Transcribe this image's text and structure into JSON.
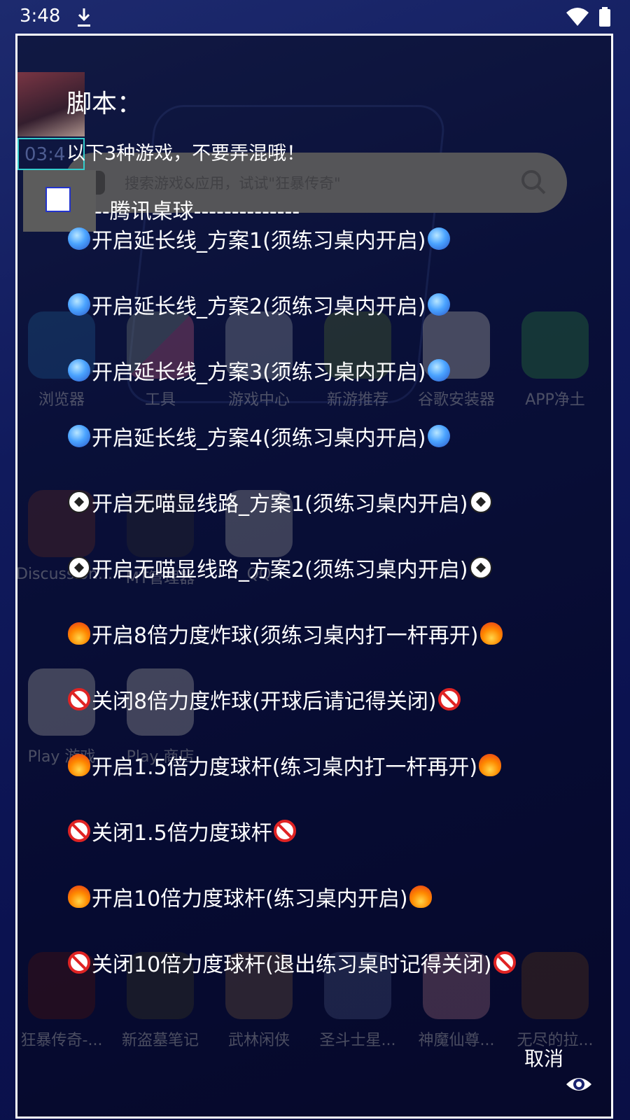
{
  "status_bar": {
    "time": "3:48"
  },
  "launcher": {
    "search_placeholder": "搜索游戏&应用，试试\"狂暴传奇\"",
    "row1": [
      "浏览器",
      "工具",
      "游戏中心",
      "新游推荐",
      "谷歌安装器",
      "APP净土"
    ],
    "row2": [
      "Discussion...",
      "MT管理器",
      "QQ"
    ],
    "row3": [
      "Play 游戏",
      "Play 商店"
    ],
    "dock": [
      "狂暴传奇-...",
      "新盗墓笔记",
      "武林闲侠",
      "圣斗士星...",
      "神魔仙尊...",
      "无尽的拉..."
    ]
  },
  "dialog": {
    "title": "脚本：",
    "subtitle": "以下3种游戏，不要弄混哦！",
    "overlay_time": "03:4",
    "section_label": "--腾讯桌球--------------",
    "options": [
      {
        "icon": "crystal-ball-icon",
        "label": "开启延长线_方案1(须练习桌内开启)"
      },
      {
        "icon": "crystal-ball-icon",
        "label": "开启延长线_方案2(须练习桌内开启)"
      },
      {
        "icon": "crystal-ball-icon",
        "label": "开启延长线_方案3(须练习桌内开启)"
      },
      {
        "icon": "crystal-ball-icon",
        "label": "开启延长线_方案4(须练习桌内开启)"
      },
      {
        "icon": "soccer-ball-icon",
        "label": "开启无喵显线路_方案1(须练习桌内开启)"
      },
      {
        "icon": "soccer-ball-icon",
        "label": "开启无喵显线路_方案2(须练习桌内开启)"
      },
      {
        "icon": "fire-icon",
        "label": "开启8倍力度炸球(须练习桌内打一杆再开)"
      },
      {
        "icon": "no-entry-icon",
        "label": "关闭8倍力度炸球(开球后请记得关闭)"
      },
      {
        "icon": "fire-icon",
        "label": "开启1.5倍力度球杆(练习桌内打一杆再开)"
      },
      {
        "icon": "no-entry-icon",
        "label": "关闭1.5倍力度球杆"
      },
      {
        "icon": "fire-icon",
        "label": "开启10倍力度球杆(练习桌内开启)"
      },
      {
        "icon": "no-entry-icon",
        "label": "关闭10倍力度球杆(退出练习桌时记得关闭)"
      }
    ],
    "cancel_label": "取消"
  }
}
